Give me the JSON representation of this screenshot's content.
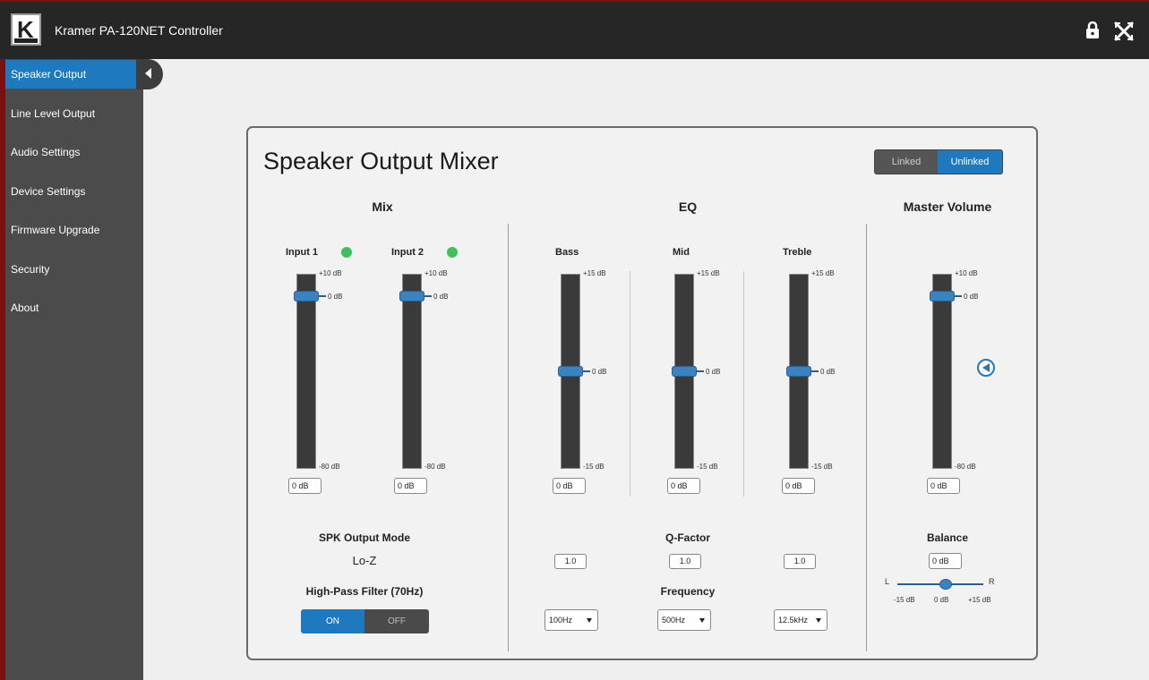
{
  "app": {
    "title": "Kramer PA-120NET Controller"
  },
  "header_icons": {
    "lock": "lock-icon",
    "close": "close-icon"
  },
  "sidebar": {
    "items": [
      {
        "label": "Speaker Output",
        "active": true
      },
      {
        "label": "Line Level Output",
        "active": false
      },
      {
        "label": "Audio Settings",
        "active": false
      },
      {
        "label": "Device Settings",
        "active": false
      },
      {
        "label": "Firmware Upgrade",
        "active": false
      },
      {
        "label": "Security",
        "active": false
      },
      {
        "label": "About",
        "active": false
      }
    ]
  },
  "panel": {
    "title": "Speaker Output Mixer",
    "link_toggle": {
      "linked": "Linked",
      "unlinked": "Unlinked",
      "selected": "Unlinked"
    }
  },
  "mix": {
    "title": "Mix",
    "channels": [
      {
        "label": "Input 1",
        "top": "+10 dB",
        "mid": "0 dB",
        "bottom": "-80 dB",
        "value": "0 dB"
      },
      {
        "label": "Input 2",
        "top": "+10 dB",
        "mid": "0 dB",
        "bottom": "-80 dB",
        "value": "0 dB"
      }
    ],
    "spk_mode_label": "SPK Output Mode",
    "spk_mode_value": "Lo-Z",
    "hpf_label": "High-Pass Filter (70Hz)",
    "hpf_on": "ON",
    "hpf_off": "OFF"
  },
  "eq": {
    "title": "EQ",
    "bands": [
      {
        "label": "Bass",
        "top": "+15 dB",
        "mid": "0 dB",
        "bottom": "-15 dB",
        "value": "0 dB",
        "q": "1.0",
        "freq": "100Hz"
      },
      {
        "label": "Mid",
        "top": "+15 dB",
        "mid": "0 dB",
        "bottom": "-15 dB",
        "value": "0 dB",
        "q": "1.0",
        "freq": "500Hz"
      },
      {
        "label": "Treble",
        "top": "+15 dB",
        "mid": "0 dB",
        "bottom": "-15 dB",
        "value": "0 dB",
        "q": "1.0",
        "freq": "12.5kHz"
      }
    ],
    "q_label": "Q-Factor",
    "freq_label": "Frequency"
  },
  "master": {
    "title": "Master Volume",
    "top": "+10 dB",
    "mid": "0 dB",
    "bottom": "-80 dB",
    "value": "0 dB",
    "balance_label": "Balance",
    "balance_value": "0 dB",
    "balance_left": "L",
    "balance_right": "R",
    "balance_min": "-15 dB",
    "balance_center": "0 dB",
    "balance_max": "+15 dB"
  },
  "colors": {
    "accent": "#1e79be",
    "header": "#262626",
    "sidebar": "#4b4b4b",
    "led": "#3ec15c"
  }
}
